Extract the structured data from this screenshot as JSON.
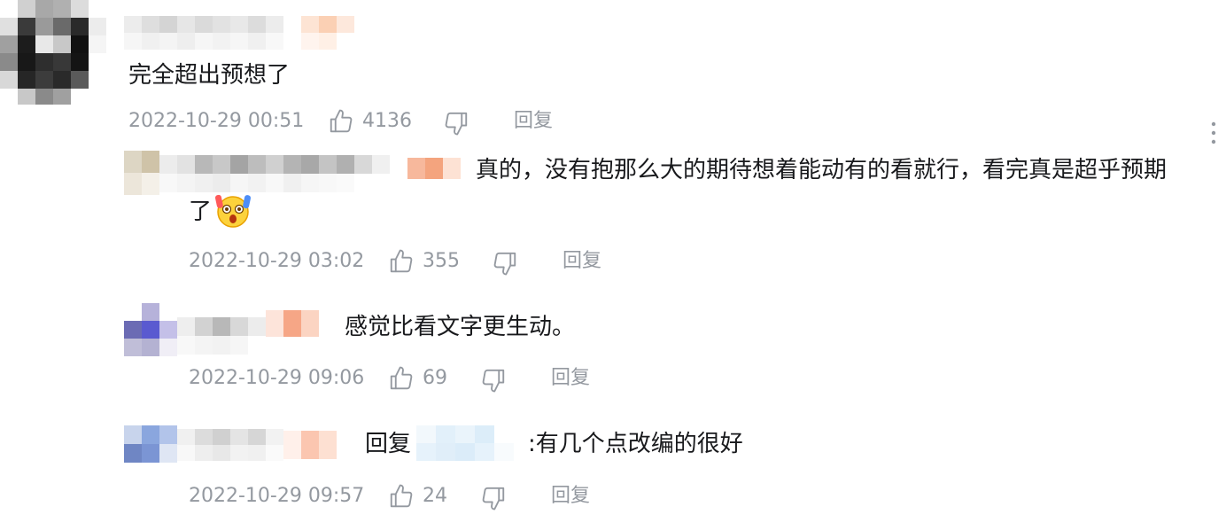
{
  "root_comment": {
    "text": "完全超出预想了",
    "time": "2022-10-29 00:51",
    "likes": "4136",
    "reply_label": "回复"
  },
  "more_menu": {
    "icon": "more-vertical-icon"
  },
  "replies": [
    {
      "text_line1": "真的，没有抱那么大的期待想着能动有的看就行，看完真是超乎预期",
      "text_line2": "了",
      "emoji": "surprised-face-emoji",
      "time": "2022-10-29 03:02",
      "likes": "355",
      "reply_label": "回复"
    },
    {
      "text": "感觉比看文字更生动。",
      "time": "2022-10-29 09:06",
      "likes": "69",
      "reply_label": "回复"
    },
    {
      "reply_prefix": "回复",
      "text": ":有几个点改编的很好",
      "time": "2022-10-29 09:57",
      "likes": "24",
      "reply_label": "回复"
    }
  ],
  "colors": {
    "text": "#18191c",
    "meta": "#9499a0",
    "icon": "#9499a0"
  }
}
